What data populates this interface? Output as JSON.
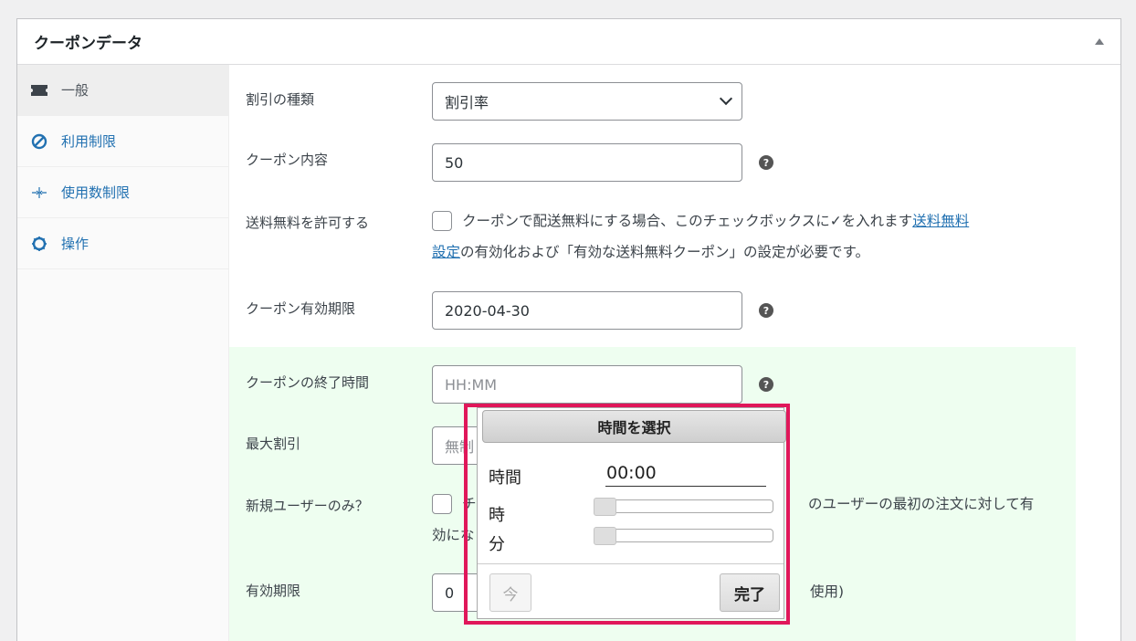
{
  "panel": {
    "title": "クーポンデータ"
  },
  "tabs": [
    {
      "label": "一般",
      "icon": "ticket-icon"
    },
    {
      "label": "利用制限",
      "icon": "block-icon"
    },
    {
      "label": "使用数制限",
      "icon": "arrows-inward-icon"
    },
    {
      "label": "操作",
      "icon": "settings-cog-icon"
    }
  ],
  "fields": {
    "discount_type": {
      "label": "割引の種類",
      "value": "割引率"
    },
    "amount": {
      "label": "クーポン内容",
      "value": "50"
    },
    "free_shipping": {
      "label": "送料無料を許可する",
      "desc_before": "クーポンで配送無料にする場合、このチェックボックスに✓を入れます",
      "link_part1": "送料無料",
      "link_part2": "設定",
      "desc_after": "の有効化および「有効な送料無料クーポン」の設定が必要です。"
    },
    "expiry": {
      "label": "クーポン有効期限",
      "value": "2020-04-30"
    },
    "end_time": {
      "label": "クーポンの終了時間",
      "placeholder": "HH:MM"
    },
    "max_discount": {
      "label": "最大割引",
      "value_fragment": "無制"
    },
    "new_user": {
      "label": "新規ユーザーのみ？",
      "desc_fragment1": "チ",
      "desc_fragment2": "のユーザーの最初の注文に対して有",
      "desc_fragment3": "効にな"
    },
    "validity": {
      "label": "有効期限",
      "value_fragment": "0",
      "suffix_fragment": "使用)"
    }
  },
  "timepicker": {
    "title": "時間を選択",
    "time_label": "時間",
    "time_value": "00:00",
    "hour_label": "時",
    "minute_label": "分",
    "hour_value": 0,
    "minute_value": 0,
    "now_label": "今",
    "done_label": "完了"
  },
  "colors": {
    "highlight": "#e0175a",
    "link": "#2271b1",
    "green_bg": "#eefef0"
  }
}
